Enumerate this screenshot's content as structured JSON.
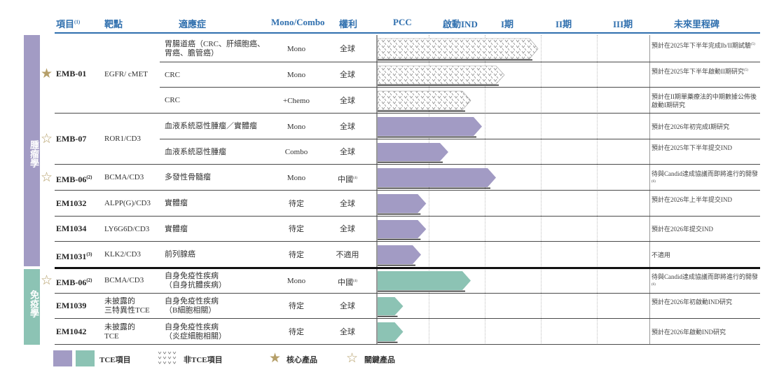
{
  "headers": {
    "item": "項目",
    "item_sup": "(1)",
    "target": "靶點",
    "indication": "適應症",
    "mono_combo": "Mono/Combo",
    "rights": "權利",
    "pcc": "PCC",
    "ind": "啟動IND",
    "phase1": "I期",
    "phase2": "II期",
    "phase3": "III期",
    "milestone": "未來里程碑"
  },
  "sections": {
    "oncology": "腫瘤學",
    "immunology": "免疫學"
  },
  "colors": {
    "purple": "#a29bc4",
    "teal": "#8cc3b4",
    "gold": "#b59f69",
    "header_blue": "#2f6fae"
  },
  "products": [
    {
      "name": "EMB-01",
      "sup": "",
      "star": "core",
      "target": "EGFR/ cMET"
    },
    {
      "name": "EMB-07",
      "sup": "",
      "star": "key",
      "target": "ROR1/CD3"
    },
    {
      "name": "EMB-06",
      "sup": "(2)",
      "star": "key",
      "target": "BCMA/CD3"
    },
    {
      "name": "EM1032",
      "sup": "",
      "star": "",
      "target": "ALPP(G)/CD3"
    },
    {
      "name": "EM1034",
      "sup": "",
      "star": "",
      "target": "LY6G6D/CD3"
    },
    {
      "name": "EM1031",
      "sup": "(3)",
      "star": "",
      "target": "KLK2/CD3"
    },
    {
      "name": "EMB-06",
      "sup": "(2)",
      "star": "key",
      "target": "BCMA/CD3"
    },
    {
      "name": "EM1039",
      "sup": "",
      "star": "",
      "target": "未披露的\n三特異性TCE"
    },
    {
      "name": "EM1042",
      "sup": "",
      "star": "",
      "target": "未披露的\nTCE"
    }
  ],
  "chart_data": {
    "type": "table",
    "stages": [
      "PCC",
      "啟動IND",
      "I期",
      "II期",
      "III期"
    ],
    "rows": [
      {
        "indication": "胃腸道癌（CRC、肝細胞癌、\n胃癌、膽管癌）",
        "mode": "Mono",
        "rights": "全球",
        "progress": 2.95,
        "kind": "hatch",
        "section": "oncology",
        "milestone": "預計在2025年下半年完成Ib/II期試驗",
        "milestone_sup": "(5)"
      },
      {
        "indication": "CRC",
        "mode": "Mono",
        "rights": "全球",
        "progress": 2.35,
        "kind": "hatch",
        "section": "oncology",
        "milestone": "預計在2025年下半年啟動II期研究",
        "milestone_sup": "(5)"
      },
      {
        "indication": "CRC",
        "mode": "+Chemo",
        "rights": "全球",
        "progress": 1.75,
        "kind": "hatch",
        "section": "oncology",
        "milestone": "預計在II期單藥療法的中期數據公佈後啟動I期研究",
        "milestone_sup": ""
      },
      {
        "indication": "血液系統惡性腫瘤／實體瘤",
        "mode": "Mono",
        "rights": "全球",
        "progress": 1.95,
        "kind": "tce",
        "section": "oncology",
        "milestone": "預計在2026年初完成I期研究",
        "milestone_sup": ""
      },
      {
        "indication": "血液系統惡性腫瘤",
        "mode": "Combo",
        "rights": "全球",
        "progress": 1.35,
        "kind": "tce",
        "section": "oncology",
        "milestone": "預計在2025年下半年提交IND",
        "milestone_sup": ""
      },
      {
        "indication": "多發性骨髓瘤",
        "mode": "Mono",
        "rights": "中國",
        "rights_sup": "(4)",
        "progress": 2.2,
        "kind": "tce",
        "section": "oncology",
        "milestone": "待與Candid達成協議而即將進行的開發",
        "milestone_sup": "(6)"
      },
      {
        "indication": "實體瘤",
        "mode": "待定",
        "rights": "全球",
        "progress": 0.95,
        "kind": "tce",
        "section": "oncology",
        "milestone": "預計在2026年上半年提交IND",
        "milestone_sup": ""
      },
      {
        "indication": "實體瘤",
        "mode": "待定",
        "rights": "全球",
        "progress": 0.95,
        "kind": "tce",
        "section": "oncology",
        "milestone": "預計在2026年提交IND",
        "milestone_sup": ""
      },
      {
        "indication": "前列腺癌",
        "mode": "待定",
        "rights": "不適用",
        "progress": 0.85,
        "kind": "tce",
        "section": "oncology",
        "milestone": "不適用",
        "milestone_sup": ""
      },
      {
        "indication": "自身免疫性疾病\n（自身抗體疾病）",
        "mode": "Mono",
        "rights": "中國",
        "rights_sup": "(4)",
        "progress": 1.75,
        "kind": "tce",
        "section": "immunology",
        "milestone": "待與Candid達成協議而即將進行的開發",
        "milestone_sup": "(6)"
      },
      {
        "indication": "自身免疫性疾病\n（B細胞相關）",
        "mode": "待定",
        "rights": "全球",
        "progress": 0.5,
        "kind": "tce",
        "section": "immunology",
        "milestone": "預計在2026年初啟動IND研究",
        "milestone_sup": ""
      },
      {
        "indication": "自身免疫性疾病\n（炎症細胞相關）",
        "mode": "待定",
        "rights": "全球",
        "progress": 0.5,
        "kind": "tce",
        "section": "immunology",
        "milestone": "預計在2026年啟動IND研究",
        "milestone_sup": ""
      }
    ]
  },
  "legend": {
    "tce": "TCE項目",
    "non_tce": "非TCE項目",
    "core": "核心產品",
    "key": "關鍵產品"
  }
}
